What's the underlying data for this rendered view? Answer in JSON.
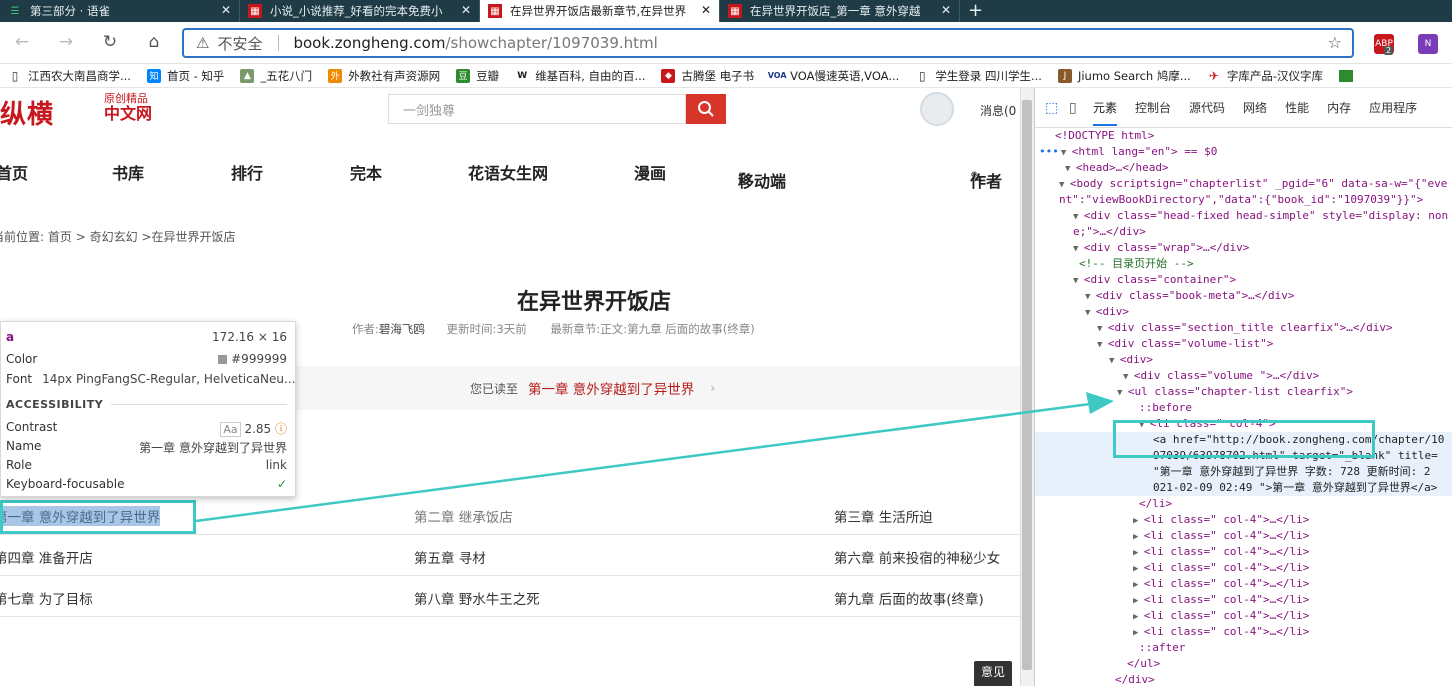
{
  "tabs": [
    {
      "title": "第三部分 · 语雀",
      "icon": "yuque-icon",
      "active": false
    },
    {
      "title": "小说_小说推荐_好看的完本免费小",
      "icon": "zongheng-icon",
      "active": false
    },
    {
      "title": "在异世界开饭店最新章节,在异世界",
      "icon": "zongheng-icon",
      "active": true
    },
    {
      "title": "在异世界开饭店_第一章 意外穿越",
      "icon": "zongheng-icon",
      "active": false
    }
  ],
  "new_tab": "+",
  "address": {
    "insecure_label": "不安全",
    "host": "book.zongheng.com",
    "path": "/showchapter/1097039.html"
  },
  "extensions": {
    "abp_badge": "2"
  },
  "bookmarks": [
    "江西农大南昌商学...",
    "首页 - 知乎",
    "_五花八门",
    "外教社有声资源网",
    "豆瓣",
    "维基百科, 自由的百...",
    "古腾堡 电子书",
    "VOA慢速英语,VOA...",
    "学生登录 四川学生...",
    "Jiumo Search 鸠摩...",
    "字库产品-汉仪字库"
  ],
  "site": {
    "logo": "纵横",
    "logo_sub1": "原创精品",
    "logo_sub2": "中文网",
    "search_placeholder": "一剑独尊",
    "messages": "消息(0",
    "nav": [
      "首页",
      "书库",
      "排行",
      "完本",
      "花语女生网",
      "漫画",
      "移动端",
      "作者"
    ],
    "breadcrumb": {
      "label": "当前位置:",
      "home": "首页",
      "sep": ">",
      "category": "奇幻玄幻",
      "book": ">在异世界开饭店"
    },
    "book_title": "在异世界开饭店",
    "meta": {
      "author_label": "作者:",
      "author": "碧海飞鸥",
      "updated_label": "更新时间:",
      "updated": "3天前",
      "latest_label": "最新章节:",
      "latest": "正文:第九章 后面的故事(终章)"
    },
    "read_label": "您已读至",
    "read_chapter": "第一章 意外穿越到了异世界",
    "read_arrow": "›",
    "chapters": [
      [
        "第一章 意外穿越到了异世界",
        "第二章 继承饭店",
        "第三章 生活所迫"
      ],
      [
        "第四章 准备开店",
        "第五章 寻材",
        "第六章 前来投宿的神秘少女"
      ],
      [
        "第七章 为了目标",
        "第八章 野水牛王之死",
        "第九章 后面的故事(终章)"
      ]
    ],
    "float_button": "意见"
  },
  "tooltip": {
    "tag": "a",
    "size": "172.16 × 16",
    "color_label": "Color",
    "color_value": "#999999",
    "font_label": "Font",
    "font_value": "14px PingFangSC-Regular, HelveticaNeu...",
    "accessibility": "ACCESSIBILITY",
    "contrast_label": "Contrast",
    "contrast_aa": "Aa",
    "contrast_value": "2.85",
    "name_label": "Name",
    "name_value": "第一章 意外穿越到了异世界",
    "role_label": "Role",
    "role_value": "link",
    "kf_label": "Keyboard-focusable"
  },
  "devtools": {
    "tabs": [
      "元素",
      "控制台",
      "源代码",
      "网络",
      "性能",
      "内存",
      "应用程序"
    ],
    "dom": [
      "<!DOCTYPE html>",
      "<html lang=\"en\"> == $0",
      "<head>…</head>",
      "<body scriptsign=\"chapterlist\" _pgid=\"6\" data-sa-w=\"{\"eve",
      "nt\":\"viewBookDirectory\",\"data\":{\"book_id\":\"1097039\"}}\">",
      "<div class=\"head-fixed head-simple\" style=\"display: non",
      "e;\">…</div>",
      "<div class=\"wrap\">…</div>",
      "<!-- 目录页开始 -->",
      "<div class=\"container\">",
      "<div class=\"book-meta\">…</div>",
      "<div>",
      "<div class=\"section_title clearfix\">…</div>",
      "<div class=\"volume-list\">",
      "<div>",
      "<div class=\"volume \">…</div>",
      "<ul class=\"chapter-list clearfix\">",
      "::before",
      "<li class=\" col-4\">",
      "<a href=\"http://book.zongheng.com/chapter/10",
      "97039/63978702.html\" target=\"_blank\" title=",
      "\"第一章 意外穿越到了异世界 字数: 728 更新时间: 2",
      "021-02-09 02:49 \">第一章 意外穿越到了异世界</a>",
      "</li>",
      "<li class=\" col-4\">…</li>",
      "<li class=\" col-4\">…</li>",
      "<li class=\" col-4\">…</li>",
      "<li class=\" col-4\">…</li>",
      "<li class=\" col-4\">…</li>",
      "<li class=\" col-4\">…</li>",
      "<li class=\" col-4\">…</li>",
      "<li class=\" col-4\">…</li>",
      "::after",
      "</ul>",
      "</div>"
    ]
  },
  "colors": {
    "accent": "#c8161d",
    "annotation": "#3ec9c4",
    "link_blue": "#2a73c5"
  }
}
